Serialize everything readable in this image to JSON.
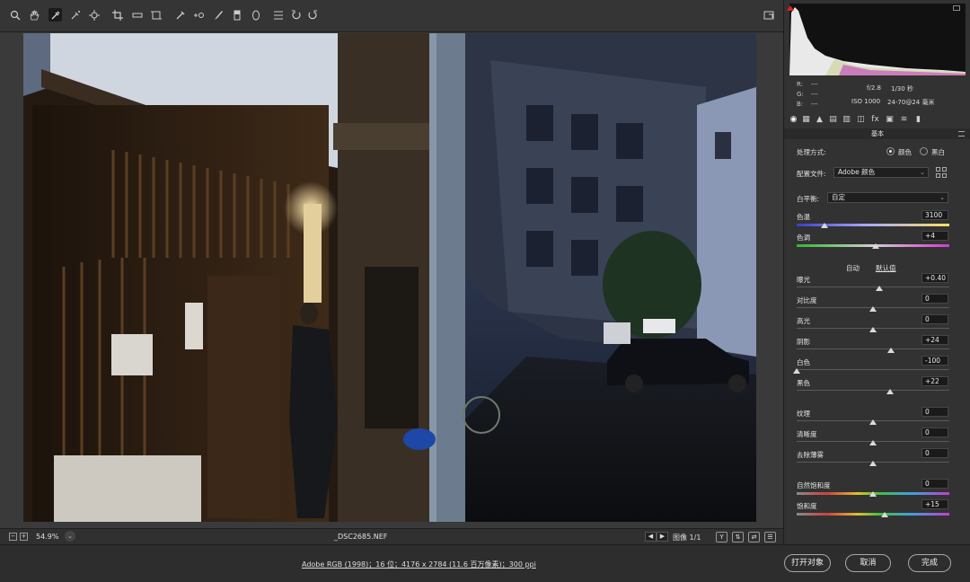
{
  "toolbar": {
    "tools": [
      "zoom-icon",
      "hand-icon",
      "white-balance-icon",
      "color-sampler-icon",
      "target-adjust-icon",
      "crop-icon",
      "straighten-icon",
      "transform-icon",
      "spot-removal-icon",
      "red-eye-icon",
      "adjustment-brush-icon",
      "graduated-filter-icon",
      "radial-filter-icon",
      "preferences-icon",
      "rotate-left-icon",
      "rotate-right-icon"
    ],
    "fullscreen_icon": "fullscreen-icon"
  },
  "viewbar": {
    "zoom": "54.9%",
    "zoom_arrow": "⌄",
    "filename": "_DSC2685.NEF",
    "image_count": "图像 1/1",
    "prev": "◀",
    "next": "▶",
    "view_btns": [
      "Y",
      "⇅",
      "⇄",
      "☰"
    ]
  },
  "footer": {
    "workflow": "Adobe RGB (1998)；16 位；4176 x 2784 (11.6 百万像素)；300 ppi",
    "open": "打开对象",
    "cancel": "取消",
    "done": "完成"
  },
  "histogram": {
    "r": "R:",
    "g": "G:",
    "b": "B:",
    "dash": "---",
    "aperture": "f/2.8",
    "shutter": "1/30 秒",
    "iso": "ISO 1000",
    "lens": "24-70@24 毫米"
  },
  "panel": {
    "section": "基本",
    "treatment_label": "处理方式:",
    "treatment_color": "颜色",
    "treatment_bw": "黑白",
    "profile_label": "配置文件:",
    "profile_value": "Adobe 颜色",
    "wb_label": "白平衡:",
    "wb_value": "自定",
    "auto": "自动",
    "default": "默认值",
    "sliders": [
      {
        "label": "色温",
        "value": "3100",
        "pos": 0.18
      },
      {
        "label": "色调",
        "value": "+4",
        "pos": 0.52
      },
      {
        "label": "曝光",
        "value": "+0.40",
        "pos": 0.54
      },
      {
        "label": "对比度",
        "value": "0",
        "pos": 0.5
      },
      {
        "label": "高光",
        "value": "0",
        "pos": 0.5
      },
      {
        "label": "阴影",
        "value": "+24",
        "pos": 0.62
      },
      {
        "label": "白色",
        "value": "-100",
        "pos": 0.0
      },
      {
        "label": "黑色",
        "value": "+22",
        "pos": 0.61
      },
      {
        "label": "纹理",
        "value": "0",
        "pos": 0.5
      },
      {
        "label": "清晰度",
        "value": "0",
        "pos": 0.5
      },
      {
        "label": "去除薄雾",
        "value": "0",
        "pos": 0.5
      },
      {
        "label": "自然饱和度",
        "value": "0",
        "pos": 0.5
      },
      {
        "label": "饱和度",
        "value": "+15",
        "pos": 0.575
      }
    ]
  },
  "colors": {
    "panel_bg": "#323232",
    "toolbar_bg": "#353535",
    "clip_warning": "#e02020"
  }
}
